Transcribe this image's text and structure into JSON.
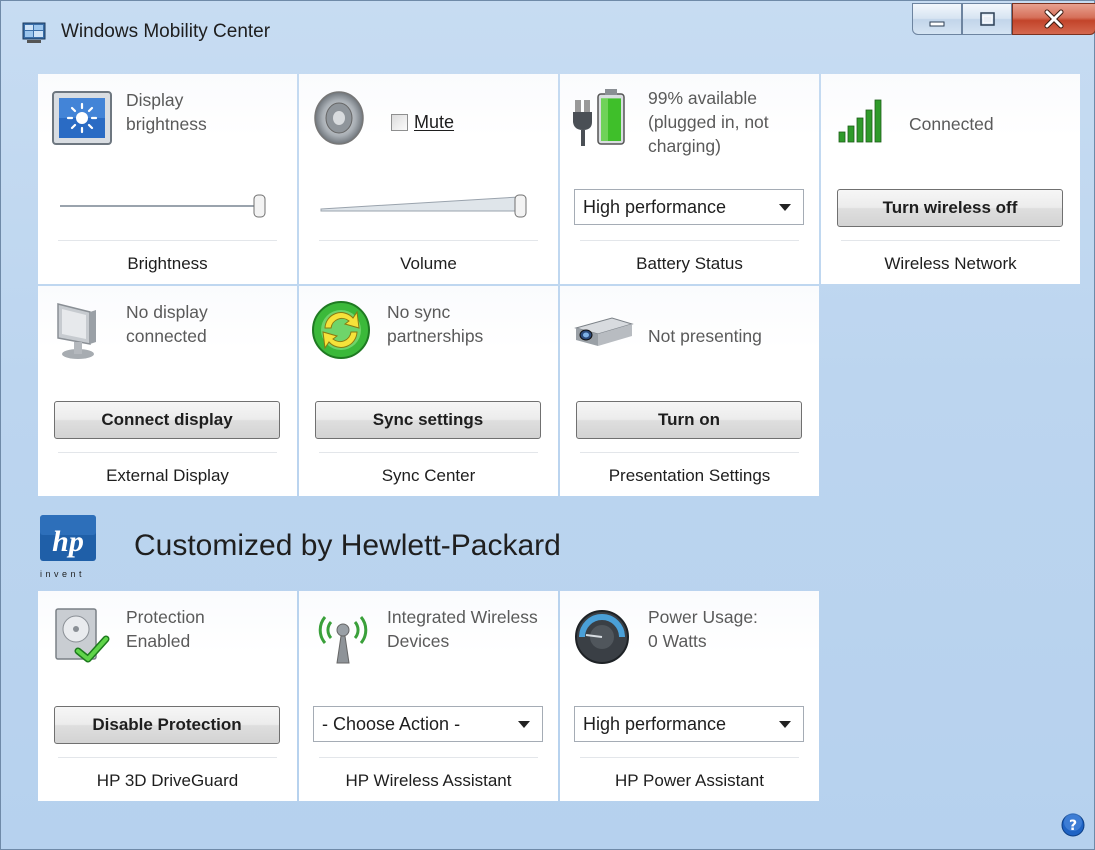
{
  "window": {
    "title": "Windows Mobility Center"
  },
  "tiles": {
    "brightness": {
      "desc": "Display brightness",
      "label": "Brightness",
      "slider_level": 1.0
    },
    "volume": {
      "mute_label": "Mute",
      "muted": false,
      "label": "Volume",
      "slider_level": 1.0
    },
    "battery": {
      "desc": "99% available (plugged in, not charging)",
      "select_value": "High performance",
      "label": "Battery Status",
      "battery_percent": 99
    },
    "wireless": {
      "desc": "Connected",
      "button": "Turn wireless off",
      "label": "Wireless Network"
    },
    "external_display": {
      "desc": "No display connected",
      "button": "Connect display",
      "label": "External Display"
    },
    "sync": {
      "desc": "No sync partnerships",
      "button": "Sync settings",
      "label": "Sync Center"
    },
    "presentation": {
      "desc": "Not presenting",
      "button": "Turn on",
      "label": "Presentation Settings"
    }
  },
  "hp": {
    "header_title": "Customized by Hewlett-Packard",
    "logo_text": "hp",
    "logo_tagline": "invent",
    "driveguard": {
      "desc": "Protection Enabled",
      "button": "Disable Protection",
      "label": "HP 3D DriveGuard"
    },
    "wireless_assistant": {
      "desc": "Integrated Wireless Devices",
      "select_value": "- Choose Action -",
      "label": "HP Wireless Assistant"
    },
    "power_assistant": {
      "desc": "Power Usage: 0 Watts",
      "select_value": "High performance",
      "label": "HP Power Assistant"
    }
  },
  "icons": {
    "app": "mobility-center-icon",
    "help": "help-icon",
    "brightness": "display-brightness-icon",
    "volume": "speaker-icon",
    "battery": "battery-plug-icon",
    "wireless": "signal-bars-icon",
    "external_display": "monitor-icon",
    "sync": "sync-arrows-icon",
    "presentation": "projector-icon",
    "driveguard": "hard-drive-shield-icon",
    "wireless_assistant": "antenna-icon",
    "power_assistant": "power-gauge-icon"
  },
  "colors": {
    "window_bg": "#bcd5ef",
    "close_button": "#c9503a",
    "battery_green": "#3fbf2a",
    "signal_green": "#2f9a2a"
  }
}
